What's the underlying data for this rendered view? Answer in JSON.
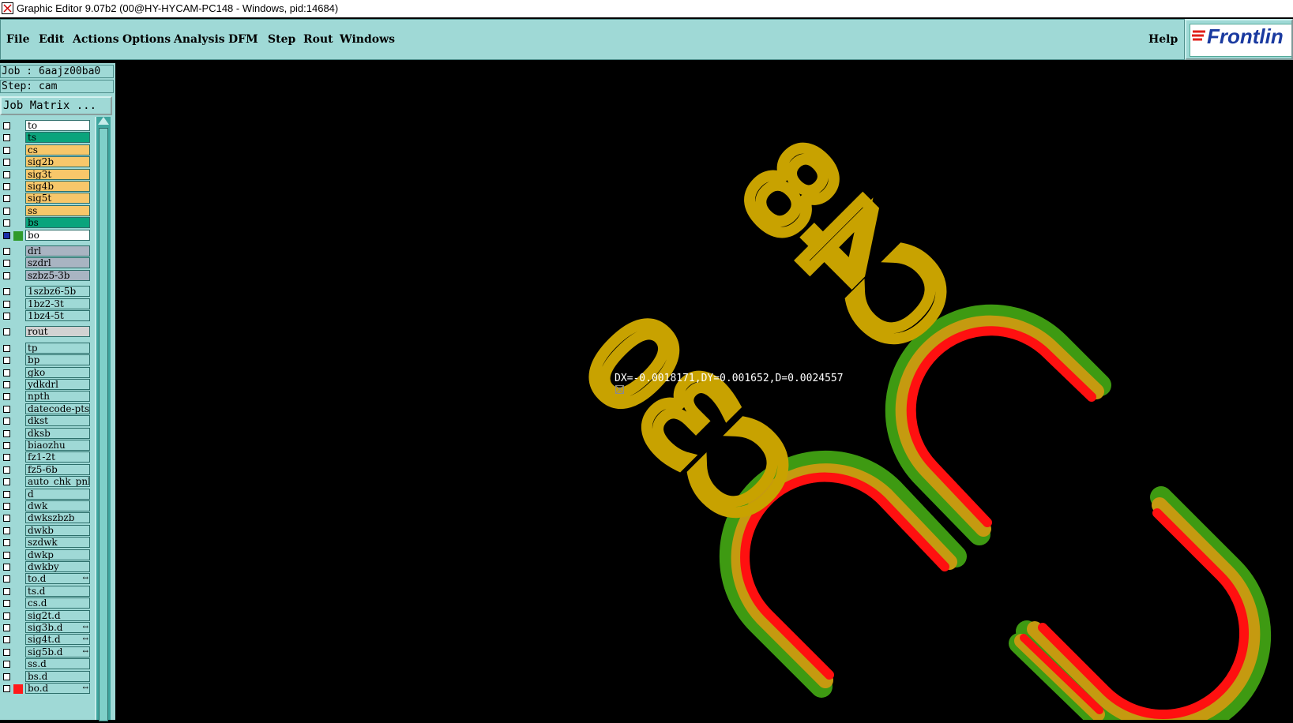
{
  "window": {
    "title": "Graphic Editor 9.07b2 (00@HY-HYCAM-PC148 - Windows, pid:14684)"
  },
  "menubar": {
    "items": [
      {
        "label": "File"
      },
      {
        "label": "Edit"
      },
      {
        "label": "Actions"
      },
      {
        "label": "Options"
      },
      {
        "label": "Analysis"
      },
      {
        "label": "DFM"
      },
      {
        "label": "Step"
      },
      {
        "label": "Rout"
      },
      {
        "label": "Windows"
      }
    ],
    "help": "Help",
    "logo": "Frontlin"
  },
  "panel": {
    "job": "Job : 6aajz00ba0",
    "step": "Step: cam",
    "job_matrix": "Job Matrix ..."
  },
  "layers": [
    {
      "name": "to",
      "color": "#ffffff"
    },
    {
      "name": "ts",
      "color": "#0aa47c"
    },
    {
      "name": "cs",
      "color": "#f7c76a"
    },
    {
      "name": "sig2b",
      "color": "#f7c76a"
    },
    {
      "name": "sig3t",
      "color": "#f7c76a"
    },
    {
      "name": "sig4b",
      "color": "#f7c76a"
    },
    {
      "name": "sig5t",
      "color": "#f7c76a"
    },
    {
      "name": "ss",
      "color": "#f7c76a"
    },
    {
      "name": "bs",
      "color": "#0aa47c"
    },
    {
      "name": "bo",
      "color": "#ffffff",
      "active": true,
      "swatch": "#2f9a2a"
    },
    {
      "name": "drl",
      "color": "#a9b4c2"
    },
    {
      "name": "szdrl",
      "color": "#a9b4c2"
    },
    {
      "name": "szbz5-3b",
      "color": "#a9b4c2"
    },
    {
      "name": "1szbz6-5b",
      "color": "#9fd9d6"
    },
    {
      "name": "1bz2-3t",
      "color": "#9fd9d6"
    },
    {
      "name": "1bz4-5t",
      "color": "#9fd9d6"
    },
    {
      "name": "rout",
      "color": "#d2d2d2"
    },
    {
      "name": "tp",
      "color": "#9fd9d6"
    },
    {
      "name": "bp",
      "color": "#9fd9d6"
    },
    {
      "name": "gko",
      "color": "#9fd9d6"
    },
    {
      "name": "ydkdrl",
      "color": "#9fd9d6"
    },
    {
      "name": "npth",
      "color": "#9fd9d6"
    },
    {
      "name": "datecode-pts",
      "color": "#9fd9d6"
    },
    {
      "name": "dkst",
      "color": "#9fd9d6"
    },
    {
      "name": "dksb",
      "color": "#9fd9d6"
    },
    {
      "name": "biaozhu",
      "color": "#9fd9d6"
    },
    {
      "name": "fz1-2t",
      "color": "#9fd9d6"
    },
    {
      "name": "fz5-6b",
      "color": "#9fd9d6"
    },
    {
      "name": "auto_chk_pnl",
      "color": "#9fd9d6"
    },
    {
      "name": "d",
      "color": "#9fd9d6"
    },
    {
      "name": "dwk",
      "color": "#9fd9d6"
    },
    {
      "name": "dwkszbzb",
      "color": "#9fd9d6"
    },
    {
      "name": "dwkb",
      "color": "#9fd9d6"
    },
    {
      "name": "szdwk",
      "color": "#9fd9d6"
    },
    {
      "name": "dwkp",
      "color": "#9fd9d6"
    },
    {
      "name": "dwkby",
      "color": "#9fd9d6"
    },
    {
      "name": "to.d",
      "color": "#9fd9d6",
      "mark": true
    },
    {
      "name": "ts.d",
      "color": "#9fd9d6"
    },
    {
      "name": "cs.d",
      "color": "#9fd9d6"
    },
    {
      "name": "sig2t.d",
      "color": "#9fd9d6"
    },
    {
      "name": "sig3b.d",
      "color": "#9fd9d6",
      "mark": true
    },
    {
      "name": "sig4t.d",
      "color": "#9fd9d6",
      "mark": true
    },
    {
      "name": "sig5b.d",
      "color": "#9fd9d6",
      "mark": true
    },
    {
      "name": "ss.d",
      "color": "#9fd9d6"
    },
    {
      "name": "bs.d",
      "color": "#9fd9d6"
    },
    {
      "name": "bo.d",
      "color": "#9fd9d6",
      "mark": true,
      "swatch": "#ff1a1a"
    }
  ],
  "canvas": {
    "measurement": "DX=-0.0018171,DY=0.001652,D=0.0024557",
    "silk_texts": [
      "C48",
      "C30"
    ],
    "colors": {
      "silk": "#c8a200",
      "red": "#ff1010",
      "green": "#3e9a12",
      "mix": "#c59a10"
    }
  }
}
